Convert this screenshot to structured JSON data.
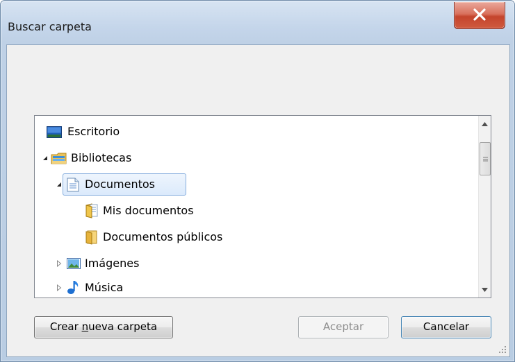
{
  "window": {
    "title": "Buscar carpeta",
    "description": ""
  },
  "tree": {
    "items": [
      {
        "label": "Escritorio",
        "icon": "desktop-icon",
        "expander": "none",
        "level": 0
      },
      {
        "label": "Bibliotecas",
        "icon": "libraries-icon",
        "expander": "expanded",
        "level": 0
      },
      {
        "label": "Documentos",
        "icon": "documents-library-icon",
        "expander": "expanded",
        "level": 1,
        "selected": true
      },
      {
        "label": "Mis documentos",
        "icon": "my-documents-folder-icon",
        "expander": "none",
        "level": 2
      },
      {
        "label": "Documentos públicos",
        "icon": "public-documents-folder-icon",
        "expander": "none",
        "level": 2
      },
      {
        "label": "Imágenes",
        "icon": "pictures-icon",
        "expander": "collapsed",
        "level": 1
      },
      {
        "label": "Música",
        "icon": "music-icon",
        "expander": "collapsed",
        "level": 1
      }
    ]
  },
  "buttons": {
    "new_folder_pre": "Crear ",
    "new_folder_mnemonic": "n",
    "new_folder_post": "ueva carpeta",
    "ok": "Aceptar",
    "cancel": "Cancelar"
  },
  "colors": {
    "selection_border": "#84acdd",
    "close_button": "#c4442c"
  }
}
